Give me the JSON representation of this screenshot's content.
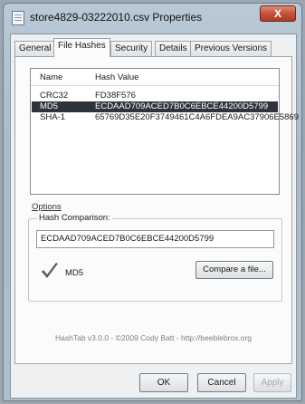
{
  "window": {
    "title": "store4829-03222010.csv Properties",
    "close_label": "X"
  },
  "tabs": [
    {
      "label": "General"
    },
    {
      "label": "File Hashes"
    },
    {
      "label": "Security"
    },
    {
      "label": "Details"
    },
    {
      "label": "Previous Versions"
    }
  ],
  "hash_list": {
    "columns": [
      "Name",
      "Hash Value"
    ],
    "rows": [
      {
        "name": "CRC32",
        "value": "FD38F576"
      },
      {
        "name": "MD5",
        "value": "ECDAAD709ACED7B0C6EBCE44200D5799"
      },
      {
        "name": "SHA-1",
        "value": "65769D35E20F3749461C4A6FDEA9AC37906E5869"
      }
    ],
    "selected_index": 1
  },
  "options_label": "Options",
  "comparison": {
    "group_label": "Hash Comparison:",
    "input_value": "ECDAAD709ACED7B0C6EBCE44200D5799",
    "algorithm_label": "MD5",
    "compare_button": "Compare a file..."
  },
  "footer": "HashTab v3.0.0 - ©2009 Cody Batt - http://beeblebrox.org",
  "buttons": {
    "ok": "OK",
    "cancel": "Cancel",
    "apply": "Apply"
  },
  "colors": {
    "selected_row": "#2e3439",
    "check_mark": "#55606a"
  }
}
